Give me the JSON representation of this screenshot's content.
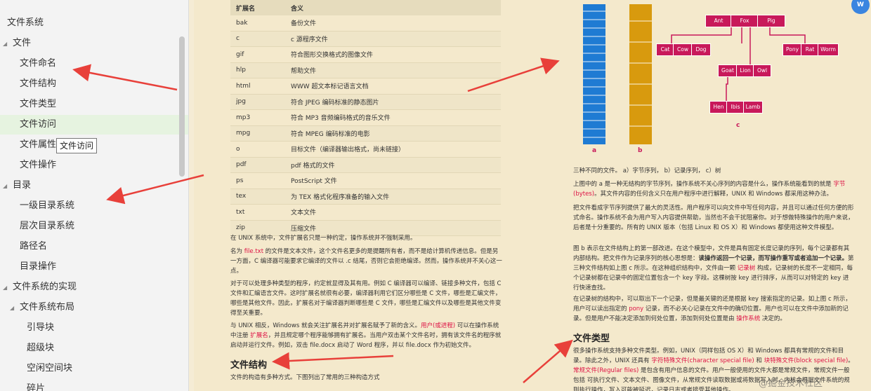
{
  "sidebar": {
    "items": [
      {
        "label": "文件系统",
        "level": 0,
        "has_toggle": false,
        "active": false
      },
      {
        "label": "文件",
        "level": 0,
        "has_toggle": true,
        "active": false
      },
      {
        "label": "文件命名",
        "level": 1,
        "has_toggle": false,
        "active": false
      },
      {
        "label": "文件结构",
        "level": 1,
        "has_toggle": false,
        "active": false
      },
      {
        "label": "文件类型",
        "level": 1,
        "has_toggle": false,
        "active": false
      },
      {
        "label": "文件访问",
        "level": 1,
        "has_toggle": false,
        "active": true
      },
      {
        "label": "文件属性",
        "level": 1,
        "has_toggle": false,
        "active": false
      },
      {
        "label": "文件操作",
        "level": 1,
        "has_toggle": false,
        "active": false
      },
      {
        "label": "目录",
        "level": 0,
        "has_toggle": true,
        "active": false
      },
      {
        "label": "一级目录系统",
        "level": 1,
        "has_toggle": false,
        "active": false
      },
      {
        "label": "层次目录系统",
        "level": 1,
        "has_toggle": false,
        "active": false
      },
      {
        "label": "路径名",
        "level": 1,
        "has_toggle": false,
        "active": false
      },
      {
        "label": "目录操作",
        "level": 1,
        "has_toggle": false,
        "active": false
      },
      {
        "label": "文件系统的实现",
        "level": 0,
        "has_toggle": true,
        "active": false
      },
      {
        "label": "文件系统布局",
        "level": 1,
        "has_toggle": true,
        "active": false
      },
      {
        "label": "引导块",
        "level": 2,
        "has_toggle": false,
        "active": false
      },
      {
        "label": "超级块",
        "level": 2,
        "has_toggle": false,
        "active": false
      },
      {
        "label": "空闲空间块",
        "level": 2,
        "has_toggle": false,
        "active": false
      },
      {
        "label": "碎片",
        "level": 2,
        "has_toggle": false,
        "active": false
      }
    ],
    "tooltip": "文件访问"
  },
  "table": {
    "headers": [
      "扩展名",
      "含义"
    ],
    "rows": [
      [
        "bak",
        "备份文件"
      ],
      [
        "c",
        "c 源程序文件"
      ],
      [
        "gif",
        "符合图形交换格式的图像文件"
      ],
      [
        "hlp",
        "帮助文件"
      ],
      [
        "html",
        "WWW 超文本标记语言文档"
      ],
      [
        "jpg",
        "符合 JPEG 编码标准的静态图片"
      ],
      [
        "mp3",
        "符合 MP3 音频编码格式的音乐文件"
      ],
      [
        "mpg",
        "符合 MPEG 编码标准的电影"
      ],
      [
        "o",
        "目标文件（编译器输出格式，尚未链接）"
      ],
      [
        "pdf",
        "pdf 格式的文件"
      ],
      [
        "ps",
        "PostScript 文件"
      ],
      [
        "tex",
        "为 TEX 格式化程序准备的输入文件"
      ],
      [
        "txt",
        "文本文件"
      ],
      [
        "zip",
        "压缩文件"
      ]
    ]
  },
  "left_text": {
    "p1": "在 UNIX 系统中，文件扩展名只是一种约定，操作系统并不强制采用。",
    "p2a": "名为 ",
    "p2code": "file.txt",
    "p2b": " 的文件是文本文件，这个文件名更多的是提醒所有者，而不是给计算机传递信息。但是另一方面，C 编译器可能要求它编译的文件以 .c 结尾，否则它会拒绝编译。然而，操作系统并不关心这一点。",
    "p3": "对于可以处理多种类型的程序，约定就显得及其有用。例如 C 编译器可以编译、链接多种文件，包括 C 文件和汇编语言文件。这时扩展名就很有必要，编译器利用它们区分哪些是 C 文件，哪些是汇编文件，哪些是其他文件。因此，扩展名对于编译器判断哪些是 C 文件，哪些是汇编文件以及哪些是其他文件变得至关重要。",
    "p4a": "与 UNIX 相反，Windows 就会关注扩展名并对扩展名赋予了新的含义。",
    "p4link1": "用户(或进程)",
    "p4b": " 可以在操作系统中注册 ",
    "p4link2": "扩展名",
    "p4c": "，并且规定哪个程序能够拥有扩展名。当用户双击某个文件名时，拥有该文件名的程序就启动并运行文件。例如，双击 file.docx 启动了 Word 程序，并以 file.docx 作为初始文件。",
    "h_structure": "文件结构",
    "p5": "文件的构造有多种方式。下图列出了常用的三种构造方式"
  },
  "figure": {
    "label_a": "a",
    "label_b": "b",
    "label_c": "c",
    "nodes": {
      "r1": "Ant",
      "r2": "Fox",
      "r3": "Pig",
      "c1": "Cat",
      "c2": "Cow",
      "c3": "Dog",
      "g1": "Goat",
      "g2": "Lion",
      "g3": "Owl",
      "p1": "Pony",
      "p2": "Rat",
      "p3": "Worm",
      "h1": "Hen",
      "h2": "Ibis",
      "h3": "Lamb"
    }
  },
  "right_text": {
    "caption": "三种不同的文件。 a）字节序列， b）记录序列， c）树",
    "p1a": "上图中的 a 是一种无结构的字节序列，操作系统不关心序列的内容是什么，操作系统能看到的就是 ",
    "p1link": "字节(bytes)",
    "p1b": "。其文件内容的任何含义只在用户程序中进行解释，UNIX 和 Windows 都采用这种办法。",
    "p2": "把文件看成字节序列提供了最大的灵活性。用户程序可以向文件中写任何内容，并且可以通过任何方便的形式命名。操作系统不会为用户写入内容提供帮助，当然也不会干扰阻塞你。对于想做特殊操作的用户来说，后者是十分重要的。所有的 UNIX 版本（包括 Linux 和 OS X）和 Windows 都使用这种文件模型。",
    "p3a": "图 b 表示在文件结构上的第一部改进。在这个模型中，文件是具有固定长度记录的序列，每个记录都有其内部结构。把文件作为记录序列的核心思想是：",
    "p3bold": "读操作返回一个记录，而写操作重写或者追加一个记录。",
    "p3b": "第三种文件结构如上图 c 所示。在这种组织结构中，文件由一颗 ",
    "p3link": "记录树",
    "p3c": " 构成，记录树的长度不一定相同，每个记录树都在记录中的固定位置包含一个 key 字段。这棵树按 key 进行排序，从而可以对特定的 key 进行快速查找。",
    "p4a": "在记录树的结构中，可以取出下一个记录，但是最关键的还是根据 key 搜索指定的记录。如上图 c 所示，用户可以读出指定的 ",
    "p4link1": "pony",
    "p4b": " 记录，而不必关心记录在文件中的确切位置。用户也可以在文件中添加新的记录。但是用户不能决定添加到何处位置，添加到何处位置是由 ",
    "p4link2": "操作系统",
    "p4c": " 决定的。",
    "h_types": "文件类型",
    "p5a": "很多操作系统支持多种文件类型。例如，UNIX（同样包括 OS X）和 Windows 都具有常规的文件和目录。除此之外，UNIX 还具有 ",
    "p5link1": "字符特殊文件(character special file)",
    "p5b": " 和 ",
    "p5link2": "块特殊文件(block special file)",
    "p5c": "。",
    "p5link3": "常规文件(Regular files)",
    "p5d": " 是包含有用户信息的文件。用户一般使用的文件大都是常规文件，常规文件一般包括 可执行文件、文本文件、图像文件，从常规文件读取数据或将数据写入时，内核会根据文件系统的规则执行操作，写入可能被延迟，记录日志或者接受其他操作。"
  },
  "watermark": "@掘金技术社区",
  "colors": {
    "tree_node": "#c8195a",
    "bar_a": "#1f7bd3",
    "bar_b": "#d89a0e",
    "annotation_arrow": "#e8403a",
    "accent_text": "#d14"
  }
}
